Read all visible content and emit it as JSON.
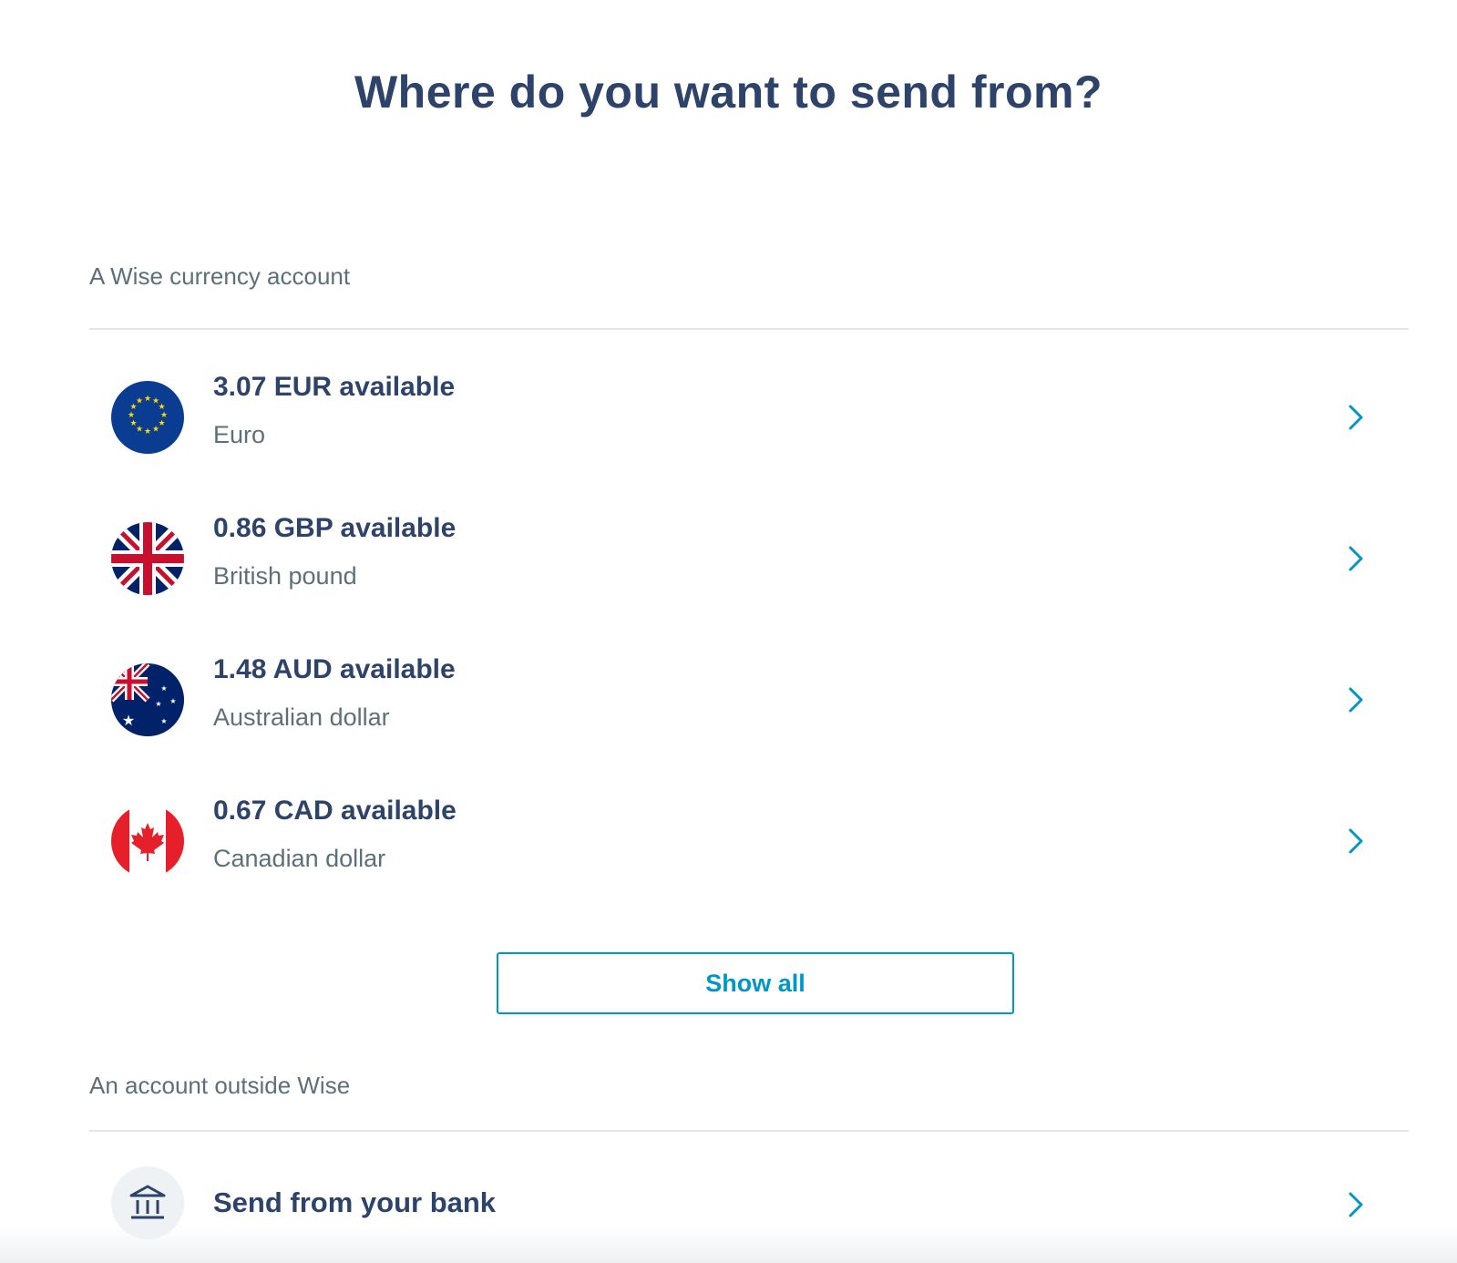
{
  "page": {
    "title": "Where do you want to send from?"
  },
  "wise_section": {
    "label": "A Wise currency account",
    "accounts": [
      {
        "amount": "3.07 EUR available",
        "currency_name": "Euro",
        "flag_icon": "eu-flag-icon"
      },
      {
        "amount": "0.86 GBP available",
        "currency_name": "British pound",
        "flag_icon": "uk-flag-icon"
      },
      {
        "amount": "1.48 AUD available",
        "currency_name": "Australian dollar",
        "flag_icon": "au-flag-icon"
      },
      {
        "amount": "0.67 CAD available",
        "currency_name": "Canadian dollar",
        "flag_icon": "ca-flag-icon"
      }
    ],
    "show_all_label": "Show all"
  },
  "outside_section": {
    "label": "An account outside Wise",
    "bank_option": {
      "label": "Send from your bank",
      "icon": "bank-icon"
    }
  },
  "colors": {
    "heading": "#2e4369",
    "secondary_text": "#5d7079",
    "accent": "#0097c7",
    "divider": "#e2e6e8"
  }
}
